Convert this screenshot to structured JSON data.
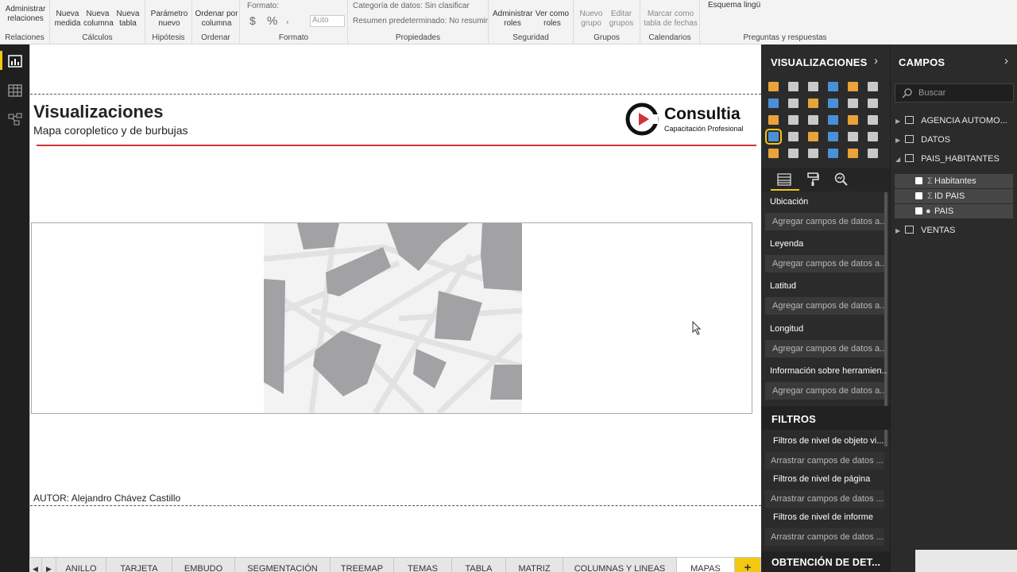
{
  "ribbon": {
    "groups": [
      {
        "label": "Relaciones",
        "buttons": [
          "Administrar relaciones"
        ]
      },
      {
        "label": "Cálculos",
        "buttons": [
          "Nueva medida",
          "Nueva columna",
          "Nueva tabla"
        ]
      },
      {
        "label": "Hipótesis",
        "buttons": [
          "Parámetro nuevo"
        ]
      },
      {
        "label": "Ordenar",
        "buttons": [
          "Ordenar por columna"
        ]
      },
      {
        "label": "Formato",
        "format_label": "Formato:",
        "currency": "$",
        "percent": "%",
        "comma": ",",
        "auto": "Auto"
      },
      {
        "label": "Propiedades",
        "category": "Categoría de datos: Sin clasificar",
        "summary": "Resumen predeterminado: No resumir"
      },
      {
        "label": "Seguridad",
        "buttons": [
          "Administrar roles",
          "Ver como roles"
        ]
      },
      {
        "label": "Grupos",
        "buttons": [
          "Nuevo grupo",
          "Editar grupos"
        ]
      },
      {
        "label": "Calendarios",
        "buttons": [
          "Marcar como tabla de fechas"
        ]
      },
      {
        "label": "Preguntas y respuestas",
        "buttons": [
          "Esquema lingüístico"
        ]
      }
    ]
  },
  "left_nav": {
    "icons": [
      "report-icon",
      "data-icon",
      "model-icon"
    ]
  },
  "report": {
    "title": "Visualizaciones",
    "subtitle": "Mapa coropletico y de burbujas",
    "logo_name": "Consultia",
    "logo_tagline": "Capacitación Profesional",
    "author": "AUTOR: Alejandro Chávez Castillo",
    "accent": "#d13438"
  },
  "tabs": [
    "ANILLO",
    "TARJETA",
    "EMBUDO",
    "SEGMENTACIÓN",
    "TREEMAP",
    "TEMAS",
    "TABLA",
    "MATRIZ",
    "COLUMNAS Y LINEAS",
    "MAPAS"
  ],
  "active_tab": "MAPAS",
  "add_tab": "+",
  "viz_pane": {
    "title": "VISUALIZACIONES",
    "wells": [
      {
        "label": "Ubicación",
        "placeholder": "Agregar campos de datos a..."
      },
      {
        "label": "Leyenda",
        "placeholder": "Agregar campos de datos a..."
      },
      {
        "label": "Latitud",
        "placeholder": "Agregar campos de datos a..."
      },
      {
        "label": "Longitud",
        "placeholder": "Agregar campos de datos a..."
      },
      {
        "label": "Información sobre herramien...",
        "placeholder": "Agregar campos de datos a..."
      }
    ],
    "filters_title": "FILTROS",
    "filters": [
      {
        "label": "Filtros de nivel de objeto vi...",
        "placeholder": "Arrastrar campos de datos ..."
      },
      {
        "label": "Filtros de nivel de página",
        "placeholder": "Arrastrar campos de datos ..."
      },
      {
        "label": "Filtros de nivel de informe",
        "placeholder": "Arrastrar campos de datos ..."
      }
    ],
    "drill_title": "OBTENCIÓN DE DET..."
  },
  "fields_pane": {
    "title": "CAMPOS",
    "search_placeholder": "Buscar",
    "tables": [
      "AGENCIA AUTOMO...",
      "DATOS",
      "PAIS_HABITANTES",
      "VENTAS"
    ],
    "fields": [
      {
        "name": "Habitantes",
        "icon": "sigma-icon"
      },
      {
        "name": "ID PAIS",
        "icon": "sigma-icon"
      },
      {
        "name": "PAIS",
        "icon": "globe-icon"
      }
    ]
  }
}
